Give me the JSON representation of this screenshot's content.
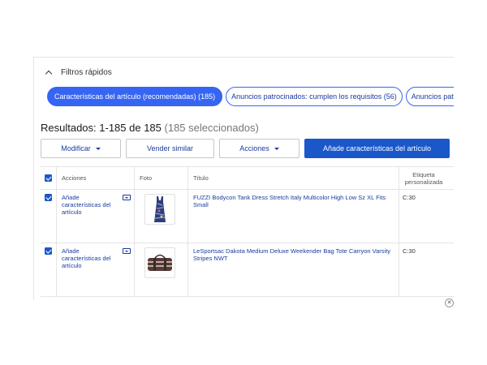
{
  "quick_filters": {
    "label": "Filtros rápidos",
    "pills": [
      {
        "label": "Características del artículo (recomendadas) (185)",
        "active": true
      },
      {
        "label": "Anuncios patrocinados: cumplen los requisitos (56)",
        "active": false
      },
      {
        "label": "Anuncios patrocinados: pa",
        "active": false
      }
    ]
  },
  "results": {
    "text": "Resultados: 1-185 de 185",
    "selected": "(185 seleccionados)"
  },
  "toolbar": {
    "modify": "Modificar",
    "sell_similar": "Vender similar",
    "actions": "Acciones",
    "add_features": "Añade características del artículo"
  },
  "table": {
    "headers": {
      "actions": "Acciones",
      "photo": "Foto",
      "title": "Título",
      "custom_label": "Etiqueta personalizada"
    },
    "rows": [
      {
        "action": "Añade características del artículo",
        "title": "FUZZI Bodycon Tank Dress Stretch Italy Multicolor High Low Sz XL Fits Small",
        "label": "C:30"
      },
      {
        "action": "Añade características del artículo",
        "title": "LeSportsac Dakota Medium Deluxe Weekender Bag Tote Carryon Varsity Stripes NWT",
        "label": "C:30"
      }
    ]
  },
  "icons": {
    "collapse": "chevron-up-icon",
    "close": "close-icon"
  },
  "colors": {
    "accent": "#3665f3",
    "primary_button": "#1a57c9",
    "link": "#1a3b9e"
  }
}
